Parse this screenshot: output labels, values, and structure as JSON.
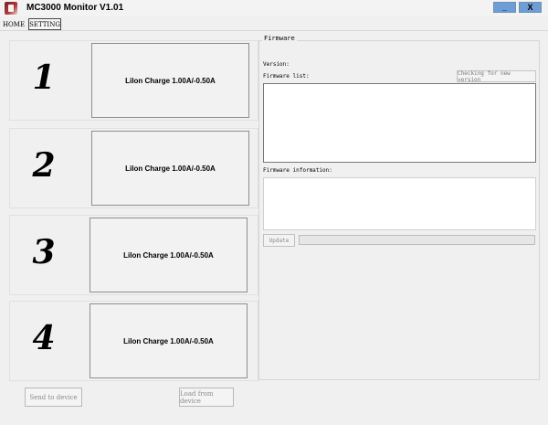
{
  "window": {
    "title": "MC3000 Monitor V1.01",
    "minimize_label": "_",
    "close_label": "X"
  },
  "tabs": [
    {
      "label": "HOME",
      "active": false
    },
    {
      "label": "SETTING",
      "active": true
    }
  ],
  "channels": [
    {
      "number": "1",
      "status": "LiIon  Charge  1.00A/-0.50A"
    },
    {
      "number": "2",
      "status": "LiIon  Charge  1.00A/-0.50A"
    },
    {
      "number": "3",
      "status": "LiIon  Charge  1.00A/-0.50A"
    },
    {
      "number": "4",
      "status": "LiIon  Charge  1.00A/-0.50A"
    }
  ],
  "buttons": {
    "send": "Send to device",
    "load": "Load from device"
  },
  "firmware": {
    "caption": "Firmware",
    "version_label": "Version:",
    "list_label": "Firmware list:",
    "check_button": "Checking for new version",
    "info_label": "Firmware information:",
    "update_button": "Update",
    "progress": 0
  }
}
